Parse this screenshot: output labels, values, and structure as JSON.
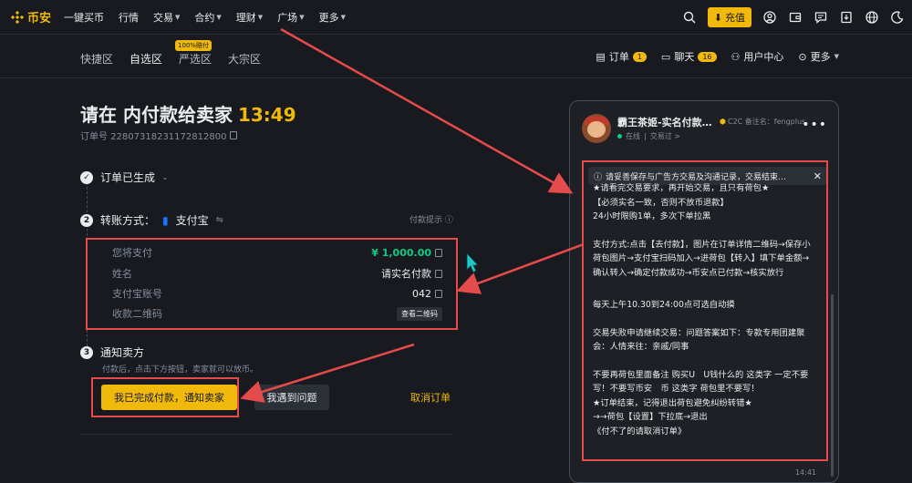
{
  "topnav": {
    "logo_text": "币安",
    "items": [
      "一键买币",
      "行情",
      "交易",
      "合约",
      "理财",
      "广场",
      "更多"
    ],
    "deposit_label": "充值"
  },
  "subnav": {
    "tabs": [
      "快捷区",
      "自选区",
      "严选区",
      "大宗区"
    ],
    "promo_badge": "100%赔付",
    "orders_label": "订单",
    "orders_count": "1",
    "chat_label": "聊天",
    "chat_count": "16",
    "user_center": "用户中心",
    "more": "更多"
  },
  "order": {
    "title": "请在 内付款给卖家",
    "timer": "13:49",
    "order_no_label": "订单号",
    "order_no": "22807318231172812800",
    "step1": "订单已生成",
    "step2_label": "转账方式：",
    "step2_method": "支付宝",
    "pay_tip": "付款提示",
    "rows": [
      {
        "label": "您将支付",
        "value": "¥ 1,000.00"
      },
      {
        "label": "姓名",
        "value": "请实名付款"
      },
      {
        "label": "支付宝账号",
        "value": "042"
      },
      {
        "label": "收款二维码",
        "value": "查看二维码"
      }
    ],
    "step3": "通知卖方",
    "step3_desc": "付款后，点击下方按钮，卖家就可以放币。",
    "confirm_btn": "我已完成付款，通知卖家",
    "problem_btn": "我遇到问题",
    "cancel": "取消订单"
  },
  "chat": {
    "name": "霸王茶姬-实名付款…",
    "c2c_label": "C2C 备注名：fengplus",
    "online": "在线",
    "trades": "交易过 >",
    "notice": "请妥善保存与广告方交易及沟通记录，交易结束…",
    "messages": [
      "★请看完交易要求，再开始交易，且只有荷包★\n【必须实名一致，否则不放币退款】\n24小时限购1单，多次下单拉黑",
      "支付方式:点击【去付款】，图片在订单详情二维码→保存小荷包图片→支付宝扫码加入→进荷包【转入】填下单金额→确认转入→确定付款成功→币安点已付款→核实放行",
      "每天上午10.30到24:00点可选自动摸",
      "交易失败申请继续交易：问题答案如下：专款专用团建聚会：人情来往：亲戚/同事",
      "不要再荷包里面备注 购买U　U钱什么的 这类字 一定不要写！不要写币安　币 这类字 荷包里不要写！\n★订单结束，记得退出荷包避免纠纷转错★\n→→荷包【设置】下拉底→退出\n《付不了的请取消订单》"
    ],
    "time": "14:41"
  },
  "colors": {
    "accent": "#f0b90b",
    "annotation": "#e44b4b",
    "bg": "#181a20"
  }
}
